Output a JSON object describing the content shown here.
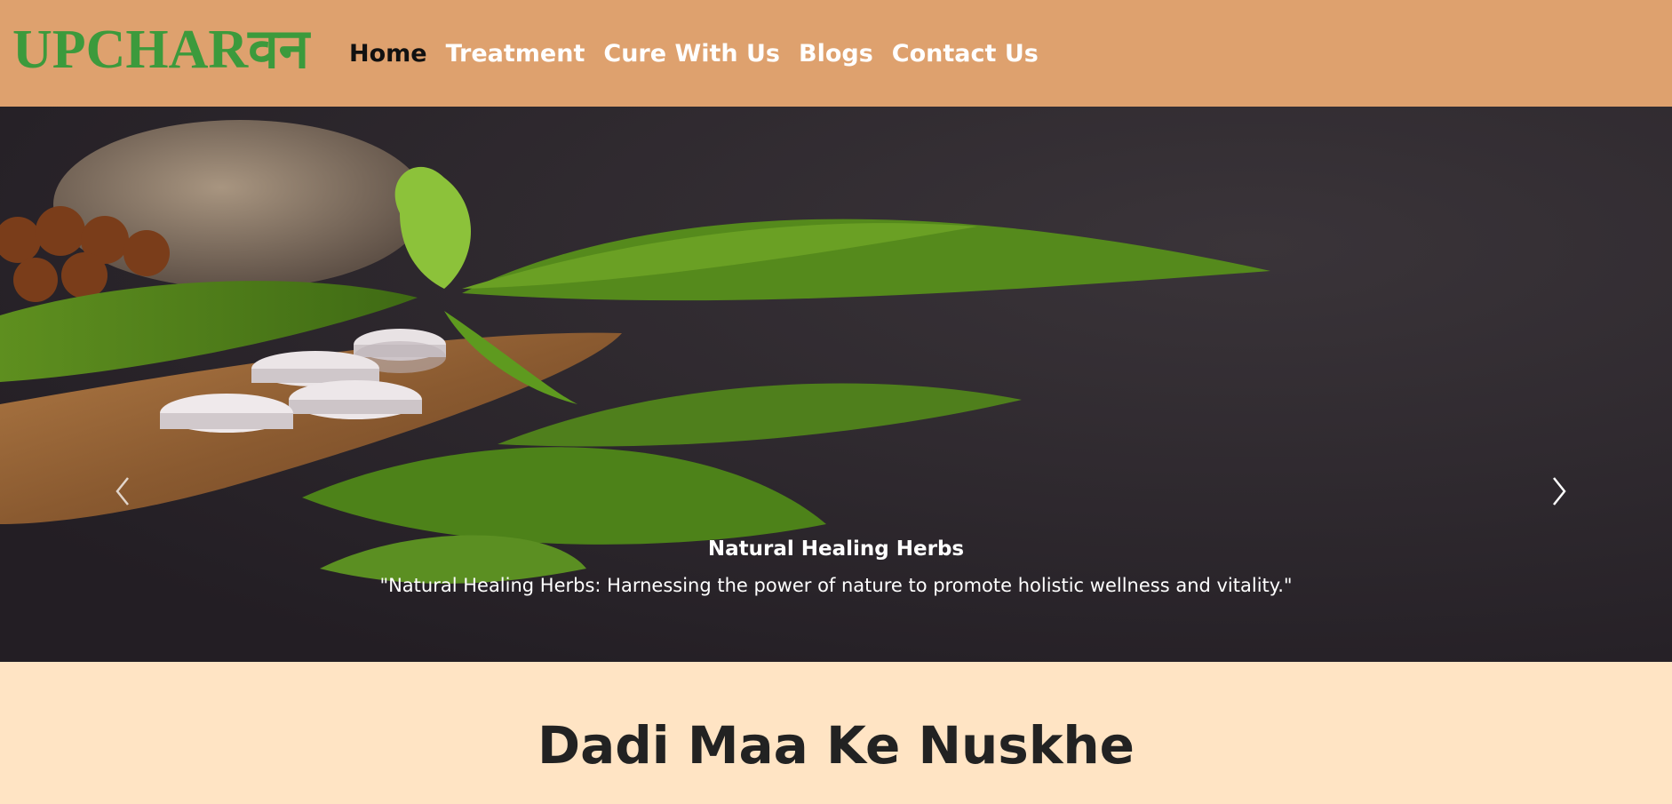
{
  "brand": {
    "name": "UPCHARवन",
    "color": "#3c9a3c"
  },
  "nav": {
    "background": "#dea16e",
    "items": [
      {
        "label": "Home",
        "active": true
      },
      {
        "label": "Treatment",
        "active": false
      },
      {
        "label": "Cure With Us",
        "active": false
      },
      {
        "label": "Blogs",
        "active": false
      },
      {
        "label": "Contact Us",
        "active": false
      }
    ]
  },
  "carousel": {
    "caption_title": "Natural Healing Herbs",
    "caption_text": "\"Natural Healing Herbs: Harnessing the power of nature to promote holistic wellness and vitality.\"",
    "prev_icon": "chevron-left-icon",
    "next_icon": "chevron-right-icon",
    "slide_count": 3,
    "active_slide": 3
  },
  "section": {
    "title": "Dadi Maa Ke Nuskhe",
    "background": "#ffe4c4"
  }
}
